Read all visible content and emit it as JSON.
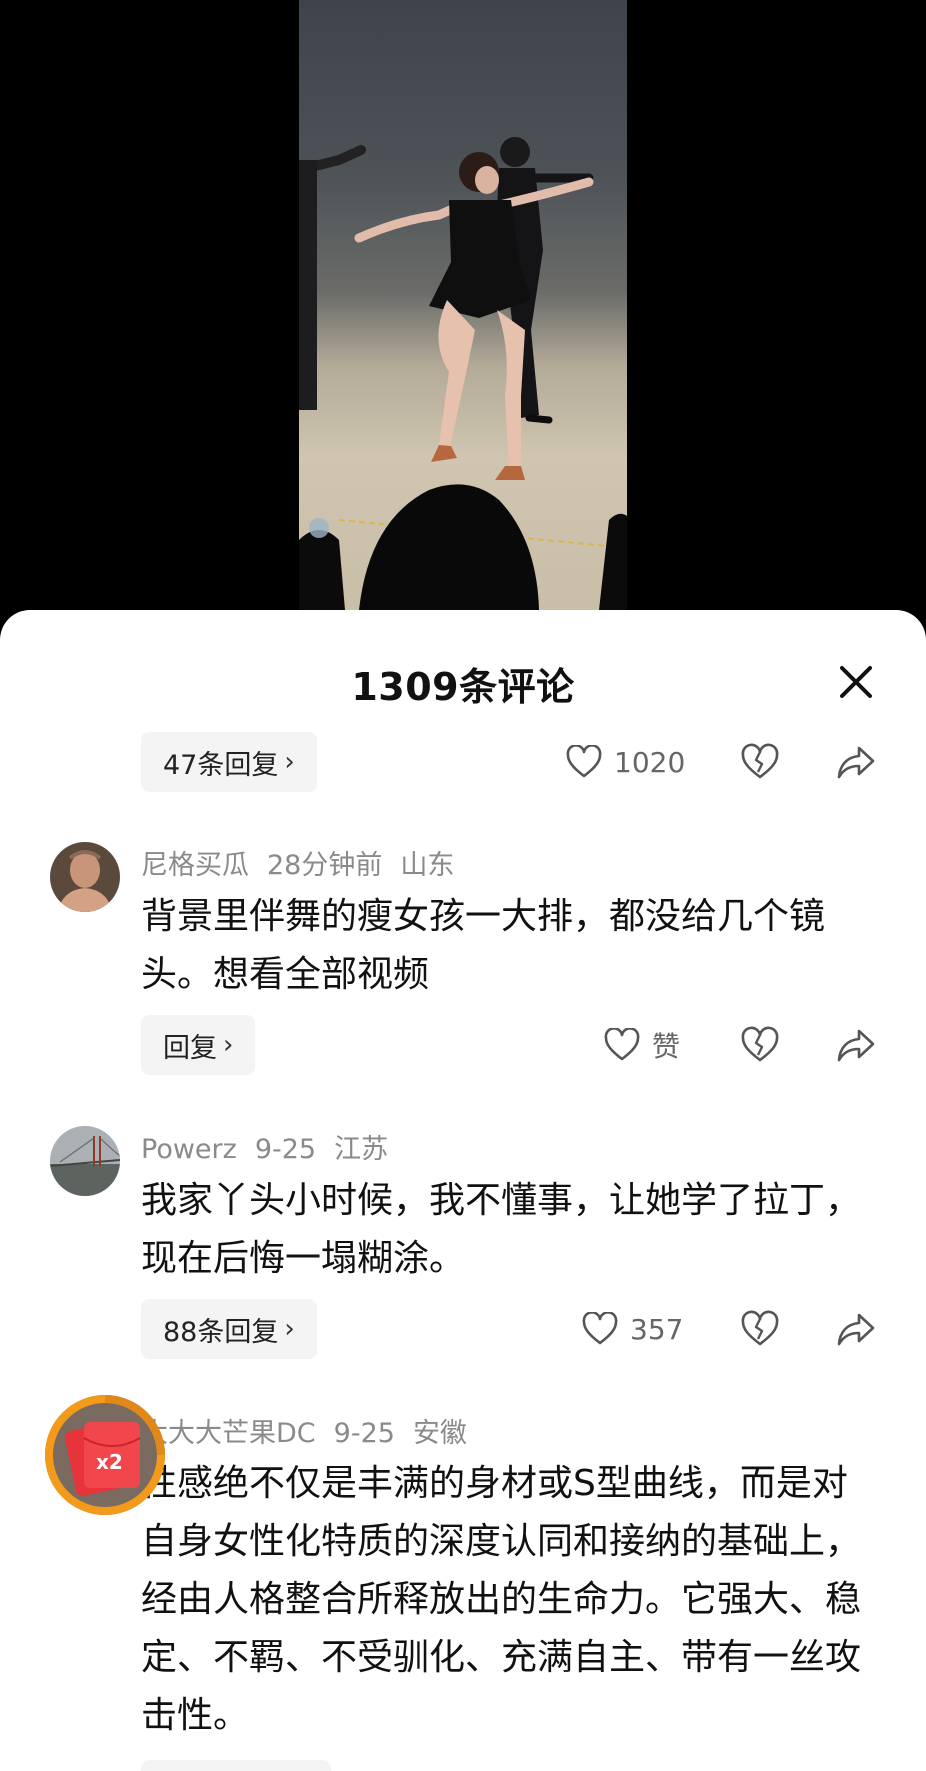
{
  "sheet": {
    "title": "1309条评论"
  },
  "comments": [
    {
      "reply_label": "47条回复",
      "likes": "1020"
    },
    {
      "user": "尼格买瓜",
      "time": "28分钟前",
      "location": "山东",
      "text": "背景里伴舞的瘦女孩一大排，都没给几个镜头。想看全部视频",
      "reply_label": "回复",
      "likes": "赞"
    },
    {
      "user": "Powerz",
      "time": "9-25",
      "location": "江苏",
      "text": "我家丫头小时候，我不懂事，让她学了拉丁，现在后悔一塌糊涂。",
      "reply_label": "88条回复",
      "likes": "357"
    },
    {
      "user": "大大大芒果DC",
      "time": "9-25",
      "location": "安徽",
      "text": "性感绝不仅是丰满的身材或S型曲线，而是对自身女性化特质的深度认同和接纳的基础上，经由人格整合所释放出的生命力。它强大、稳定、不羁、不受驯化、充满自主、带有一丝攻击性。"
    }
  ],
  "badge": {
    "label": "x2"
  },
  "icons": {
    "close": "close-icon",
    "like": "heart-icon",
    "dislike": "broken-heart-icon",
    "share": "share-arrow-icon",
    "chevron": "chevron-right-icon"
  },
  "colors": {
    "badge_red": "#e8333a",
    "badge_ring": "#f39a1a"
  }
}
